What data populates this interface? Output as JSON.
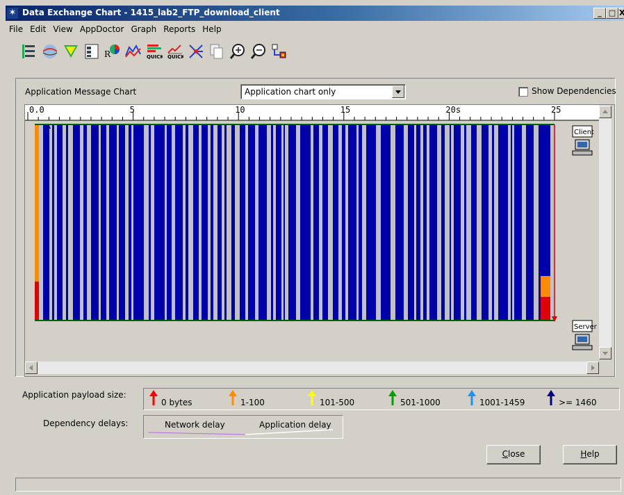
{
  "window": {
    "title": "Data Exchange Chart - 1415_lab2_FTP_download_client",
    "min_label": "_",
    "max_label": "□",
    "close_label": "X"
  },
  "menu": [
    "File",
    "Edit",
    "View",
    "AppDoctor",
    "Graph",
    "Reports",
    "Help"
  ],
  "toolbar_icons": [
    "tree-view-icon",
    "globe-icon",
    "filter-funnel-icon",
    "data-grid-icon",
    "rx-pie-icon",
    "graph-lines-icon",
    "quick-bars-icon",
    "quick-chart-icon",
    "network-star-icon",
    "copy-pages-icon",
    "zoom-in-icon",
    "zoom-out-icon",
    "connection-icon"
  ],
  "toolbar_labels": {
    "quick1": "QUICK",
    "quick2": "QUICK"
  },
  "chart_header": {
    "label": "Application Message Chart",
    "view_select": "Application chart only",
    "show_dependencies": "Show Dependencies",
    "show_dependencies_checked": false
  },
  "chart_data": {
    "type": "timeline",
    "time_axis": {
      "range": [
        0,
        25
      ],
      "ticks": [
        "0.0",
        "5",
        "10",
        "15",
        "20s",
        "25"
      ]
    },
    "endpoints": {
      "top": "Client",
      "bottom": "Server"
    },
    "colors": {
      "messages": "#0000aa",
      "gaps": "#c0c0c8",
      "baseline": "#006400"
    }
  },
  "legend": {
    "title": "Application payload size:",
    "items": [
      {
        "label": "0 bytes",
        "color": "#ff0000"
      },
      {
        "label": "1-100",
        "color": "#ff8c00"
      },
      {
        "label": "101-500",
        "color": "#ffff00"
      },
      {
        "label": "501-1000",
        "color": "#00a000"
      },
      {
        "label": "1001-1459",
        "color": "#1e90ff"
      },
      {
        "label": ">= 1460",
        "color": "#000080"
      }
    ]
  },
  "dependency": {
    "title": "Dependency delays:",
    "network": "Network delay",
    "application": "Application delay"
  },
  "buttons": {
    "close_pre": "",
    "close_u": "C",
    "close_post": "lose",
    "help_pre": "",
    "help_u": "H",
    "help_post": "elp"
  }
}
